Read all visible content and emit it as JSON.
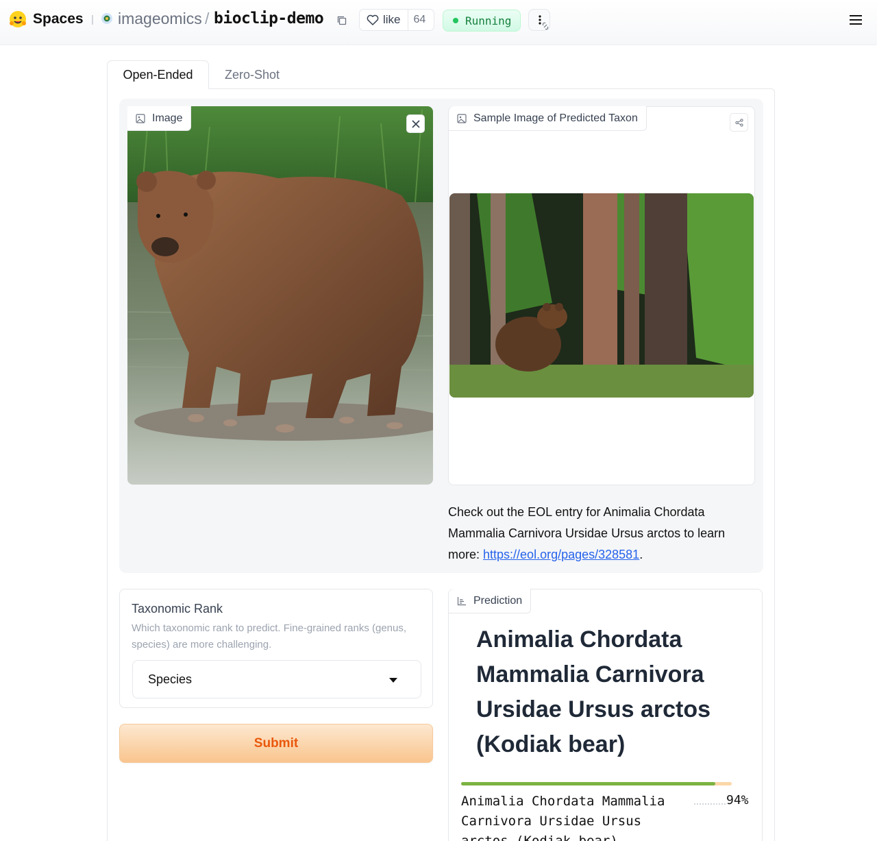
{
  "header": {
    "brand": "Spaces",
    "org": "imageomics",
    "separator": "/",
    "repo": "bioclip-demo",
    "like_label": "like",
    "like_count": "64",
    "status": "Running",
    "status_color": "#15803d"
  },
  "tabs": [
    {
      "label": "Open-Ended",
      "active": true
    },
    {
      "label": "Zero-Shot",
      "active": false
    }
  ],
  "input_image": {
    "label": "Image",
    "icon": "image-icon"
  },
  "sample_image": {
    "label": "Sample Image of Predicted Taxon",
    "icon": "image-icon"
  },
  "eol": {
    "text": "Check out the EOL entry for Animalia Chordata Mammalia Carnivora Ursidae Ursus arctos to learn more: ",
    "link": "https://eol.org/pages/328581",
    "suffix": "."
  },
  "taxonomic_rank": {
    "title": "Taxonomic Rank",
    "info": "Which taxonomic rank to predict. Fine-grained ranks (genus, species) are more challenging.",
    "value": "Species"
  },
  "submit_label": "Submit",
  "prediction": {
    "label": "Prediction",
    "heading": "Animalia Chordata Mammalia Carnivora Ursidae Ursus arctos (Kodiak bear)",
    "confidences": [
      {
        "label": "Animalia Chordata Mammalia Carnivora Ursidae Ursus arctos (Kodiak bear)",
        "percent": "94%",
        "fraction": 0.94
      }
    ],
    "bar_fill_color": "#7cb342",
    "bar_track_color": "#fbd7a8"
  }
}
